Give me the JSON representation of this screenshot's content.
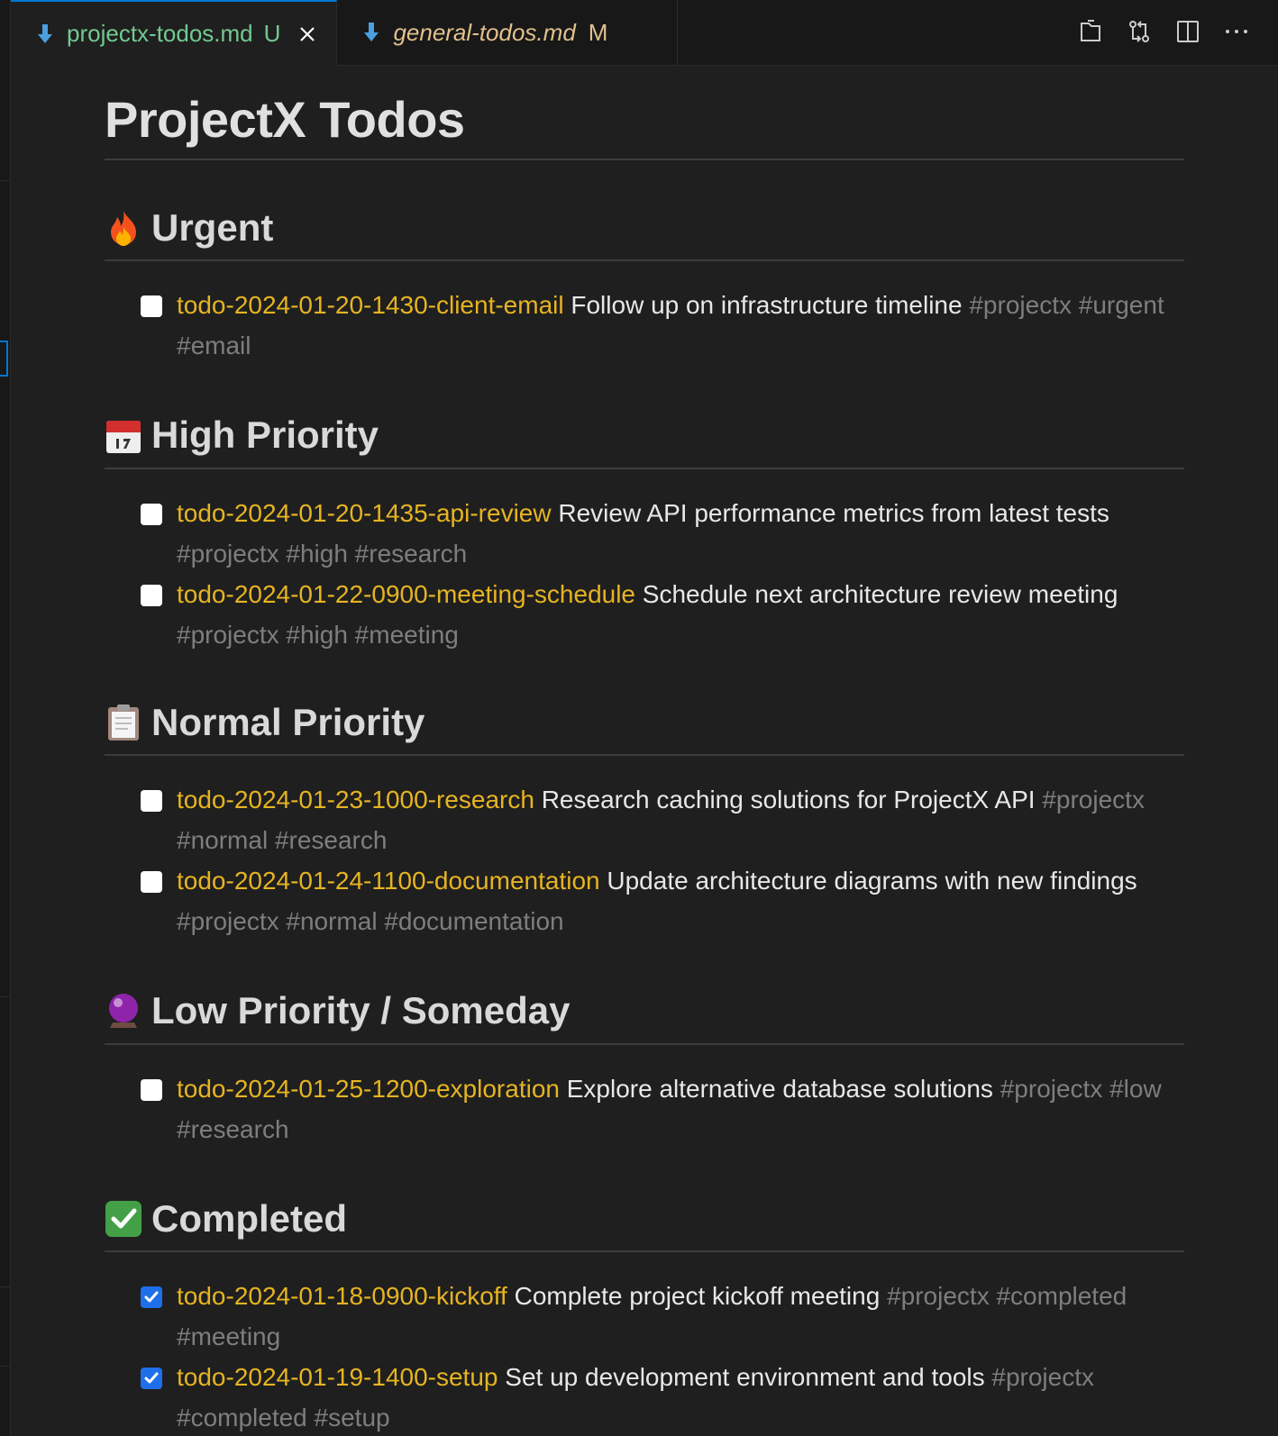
{
  "tabs": [
    {
      "name": "projectx-todos.md",
      "status": "U",
      "active": true,
      "close": "×"
    },
    {
      "name": "general-todos.md",
      "status": "M",
      "active": false
    }
  ],
  "toolbar": {
    "icons": [
      "open-preview-icon",
      "compare-changes-icon",
      "split-editor-icon",
      "more-actions-icon"
    ],
    "more": "···"
  },
  "document": {
    "title": "ProjectX Todos",
    "sections": [
      {
        "emoji": "fire",
        "heading": "Urgent",
        "items": [
          {
            "checked": false,
            "id": "todo-2024-01-20-1430-client-email",
            "text": "Follow up on infrastructure timeline",
            "tags": "#projectx #urgent #email"
          }
        ]
      },
      {
        "emoji": "calendar",
        "heading": "High Priority",
        "items": [
          {
            "checked": false,
            "id": "todo-2024-01-20-1435-api-review",
            "text": "Review API performance metrics from latest tests",
            "tags": "#projectx #high #research"
          },
          {
            "checked": false,
            "id": "todo-2024-01-22-0900-meeting-schedule",
            "text": "Schedule next architecture review meeting",
            "tags": "#projectx #high #meeting"
          }
        ]
      },
      {
        "emoji": "clipboard",
        "heading": "Normal Priority",
        "items": [
          {
            "checked": false,
            "id": "todo-2024-01-23-1000-research",
            "text": "Research caching solutions for ProjectX API",
            "tags": "#projectx #normal #research"
          },
          {
            "checked": false,
            "id": "todo-2024-01-24-1100-documentation",
            "text": "Update architecture diagrams with new findings",
            "tags": "#projectx #normal #documentation"
          }
        ]
      },
      {
        "emoji": "crystal-ball",
        "heading": "Low Priority / Someday",
        "items": [
          {
            "checked": false,
            "id": "todo-2024-01-25-1200-exploration",
            "text": "Explore alternative database solutions",
            "tags": "#projectx #low #research"
          }
        ]
      },
      {
        "emoji": "check-mark",
        "heading": "Completed",
        "items": [
          {
            "checked": true,
            "id": "todo-2024-01-18-0900-kickoff",
            "text": "Complete project kickoff meeting",
            "tags": "#projectx #completed #meeting"
          },
          {
            "checked": true,
            "id": "todo-2024-01-19-1400-setup",
            "text": "Set up development environment and tools",
            "tags": "#projectx #completed #setup"
          }
        ]
      }
    ]
  },
  "colors": {
    "background": "#1f1f1f",
    "tab_bar": "#181818",
    "active_tab_name": "#73c991",
    "modified_tab_name": "#e2c08d",
    "todo_id": "#e6b422",
    "tag": "#7e7e7e",
    "checkbox_checked": "#1f6feb",
    "accent": "#0078d4"
  }
}
